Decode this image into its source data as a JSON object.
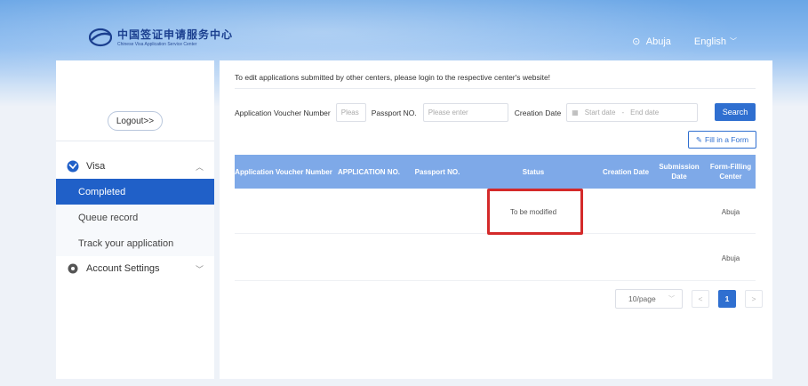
{
  "header": {
    "logo_cn": "中国签证申请服务中心",
    "logo_en": "Chinese Visa Application Service Center",
    "location": "Abuja",
    "language": "English"
  },
  "sidebar": {
    "logout_label": "Logout>>",
    "visa_group": {
      "label": "Visa",
      "items": [
        {
          "label": "Completed",
          "active": true
        },
        {
          "label": "Queue record",
          "active": false
        },
        {
          "label": "Track your application",
          "active": false
        }
      ]
    },
    "account_group": {
      "label": "Account Settings"
    }
  },
  "main": {
    "notice": "To edit applications submitted by other centers, please login to the respective center's website!",
    "filters": {
      "voucher_label": "Application Voucher Number",
      "voucher_placeholder": "Pleas",
      "passport_label": "Passport NO.",
      "passport_placeholder": "Please enter",
      "creation_label": "Creation Date",
      "start_placeholder": "Start date",
      "range_sep": "-",
      "end_placeholder": "End date",
      "search_label": "Search"
    },
    "fill_form_label": "Fill in a Form",
    "table": {
      "headers": [
        "Application Voucher Number",
        "APPLICATION NO.",
        "Passport NO.",
        "Status",
        "Creation Date",
        "Submission Date",
        "Form-Filling Center"
      ],
      "rows": [
        {
          "voucher": "",
          "app_no": "",
          "passport": "",
          "status": "To be modified",
          "created": "",
          "submitted": "",
          "center": "Abuja"
        },
        {
          "voucher": "",
          "app_no": "",
          "passport": "",
          "status": "",
          "created": "",
          "submitted": "",
          "center": "Abuja"
        }
      ]
    },
    "pagination": {
      "page_size": "10/page",
      "prev": "<",
      "current_page": "1",
      "next": ">"
    }
  },
  "colors": {
    "accent": "#2f6fd0",
    "table_header": "#7ea9e8",
    "active_menu": "#2060c8",
    "highlight_box": "#d42a2a"
  }
}
